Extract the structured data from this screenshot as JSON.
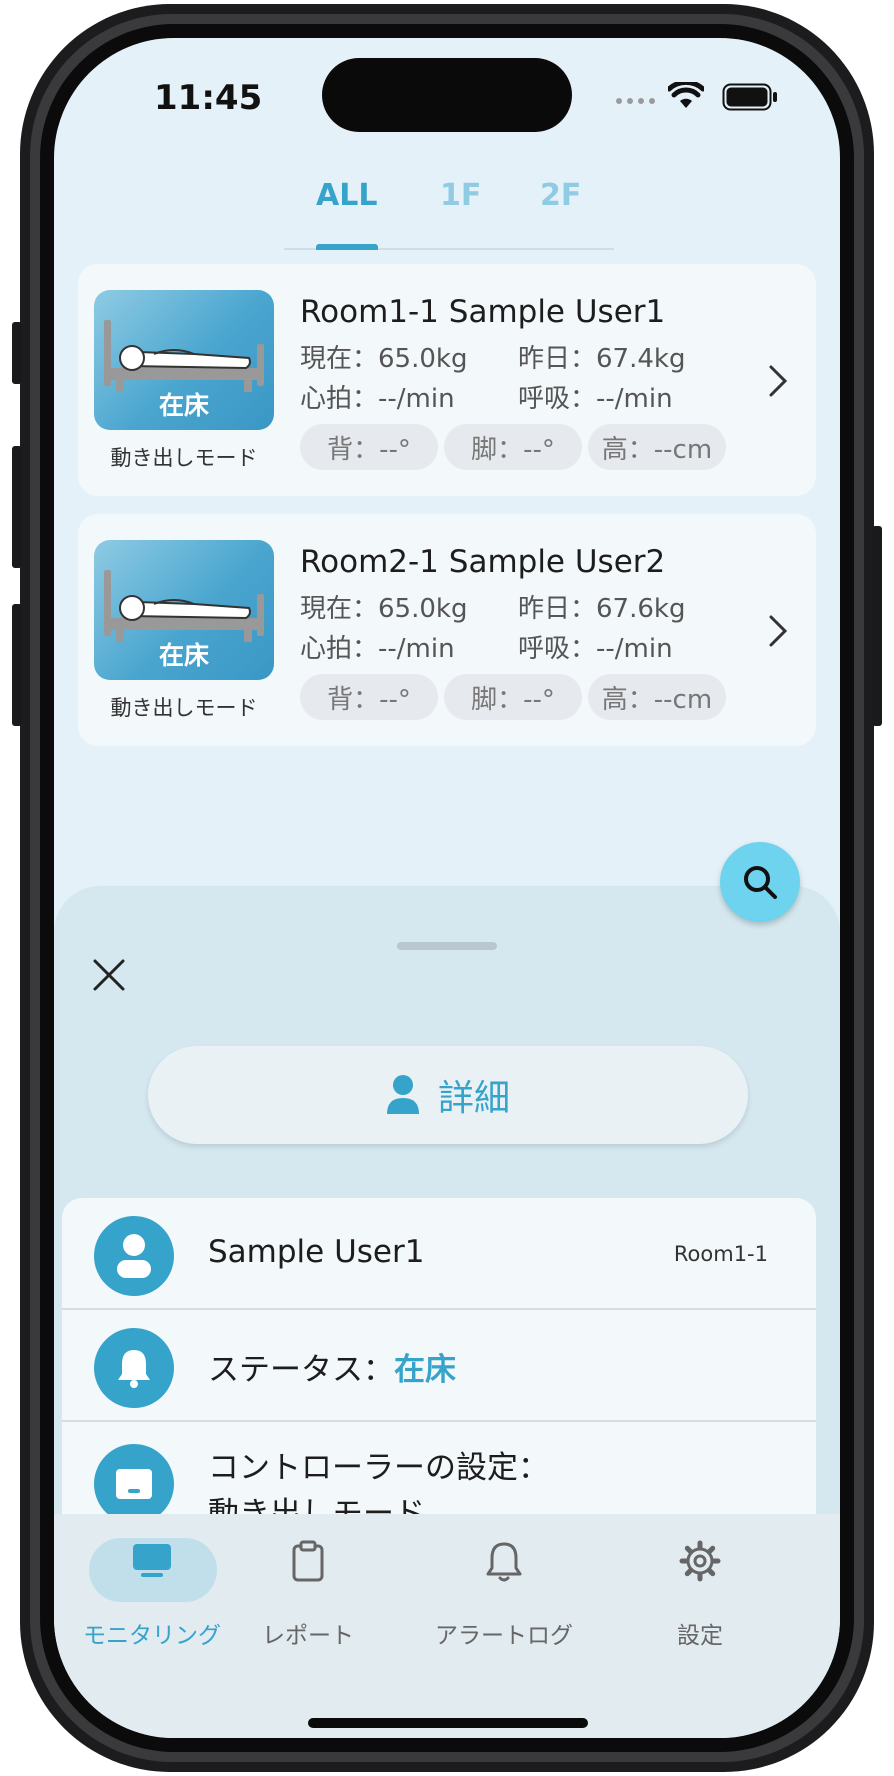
{
  "status_bar": {
    "time": "11:45"
  },
  "tabs": [
    {
      "label": "ALL",
      "active": true
    },
    {
      "label": "1F",
      "active": false
    },
    {
      "label": "2F",
      "active": false
    }
  ],
  "rooms": [
    {
      "title": "Room1-1 Sample User1",
      "bed_status": "在床",
      "mode": "動き出しモード",
      "current": "現在：65.0kg",
      "yesterday": "昨日：67.4kg",
      "heart_rate": "心拍：--/min",
      "breathing": "呼吸：--/min",
      "back": "背：--°",
      "leg": "脚：--°",
      "height": "高：--cm"
    },
    {
      "title": "Room2-1 Sample User2",
      "bed_status": "在床",
      "mode": "動き出しモード",
      "current": "現在：65.0kg",
      "yesterday": "昨日：67.6kg",
      "heart_rate": "心拍：--/min",
      "breathing": "呼吸：--/min",
      "back": "背：--°",
      "leg": "脚：--°",
      "height": "高：--cm"
    }
  ],
  "sheet": {
    "detail_button": "詳細",
    "user_name": "Sample User1",
    "room": "Room1-1",
    "status_label": "ステータス：",
    "status_value": "在床",
    "controller_label": "コントローラーの設定：",
    "controller_value": "動き出しモード"
  },
  "nav": [
    {
      "label": "モニタリング",
      "active": true,
      "icon": "monitor-icon"
    },
    {
      "label": "レポート",
      "active": false,
      "icon": "clipboard-icon"
    },
    {
      "label": "アラートログ",
      "active": false,
      "icon": "bell-icon"
    },
    {
      "label": "設定",
      "active": false,
      "icon": "gear-icon"
    }
  ],
  "colors": {
    "accent": "#36a3cb",
    "fab": "#6ed3ee",
    "background": "#e5f1f8"
  }
}
